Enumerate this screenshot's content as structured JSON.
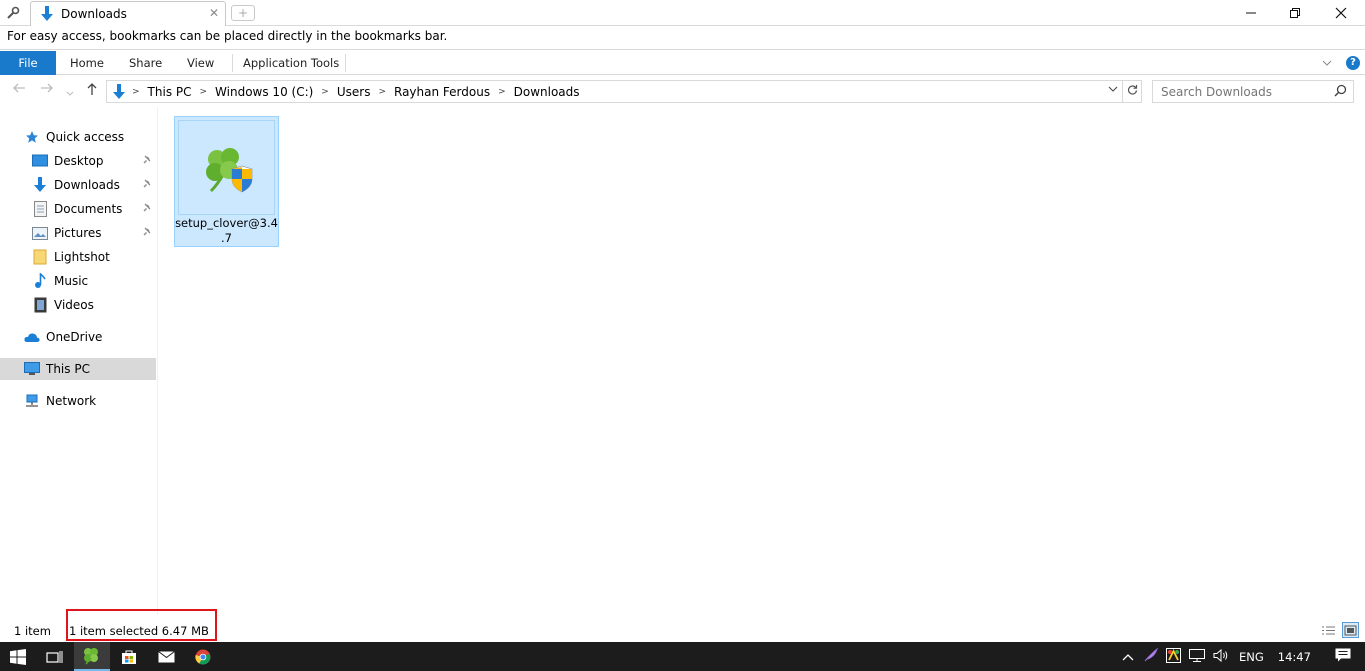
{
  "window": {
    "tab_title": "Downloads",
    "new_tab_symbol": "+",
    "close_tab_symbol": "✕",
    "minimize_symbol": "—",
    "restore_symbol": "❐",
    "close_symbol": "✕"
  },
  "bookmarks_bar": {
    "message": "For easy access, bookmarks can be placed directly in the bookmarks bar."
  },
  "ribbon": {
    "tabs": [
      "File",
      "Home",
      "Share",
      "View",
      "Application Tools"
    ],
    "help_symbol": "?"
  },
  "address": {
    "crumbs": [
      "This PC",
      "Windows 10 (C:)",
      "Users",
      "Rayhan Ferdous",
      "Downloads"
    ],
    "search_placeholder": "Search Downloads"
  },
  "sidebar": {
    "items": [
      {
        "label": "Quick access",
        "icon": "star-icon"
      },
      {
        "label": "Desktop",
        "icon": "desktop-icon",
        "pinned": true
      },
      {
        "label": "Downloads",
        "icon": "download-icon",
        "pinned": true
      },
      {
        "label": "Documents",
        "icon": "document-icon",
        "pinned": true
      },
      {
        "label": "Pictures",
        "icon": "pictures-icon",
        "pinned": true
      },
      {
        "label": "Lightshot",
        "icon": "folder-icon"
      },
      {
        "label": "Music",
        "icon": "music-icon"
      },
      {
        "label": "Videos",
        "icon": "video-icon"
      },
      {
        "label": "OneDrive",
        "icon": "cloud-icon"
      },
      {
        "label": "This PC",
        "icon": "computer-icon",
        "selected": true
      },
      {
        "label": "Network",
        "icon": "network-icon"
      }
    ]
  },
  "files": [
    {
      "name_line1": "setup_clover@3.4",
      "name_line2": ".7",
      "icon": "clover-installer-icon",
      "selected": true
    }
  ],
  "status": {
    "item_count": "1 item",
    "selection": "1 item selected  6.47 MB"
  },
  "taskbar": {
    "language": "ENG",
    "time": "14:47"
  },
  "colors": {
    "accent": "#1979ca",
    "selection_bg": "#cce8ff",
    "highlight_box": "#e0141b",
    "taskbar_bg": "#1c1c1c"
  }
}
